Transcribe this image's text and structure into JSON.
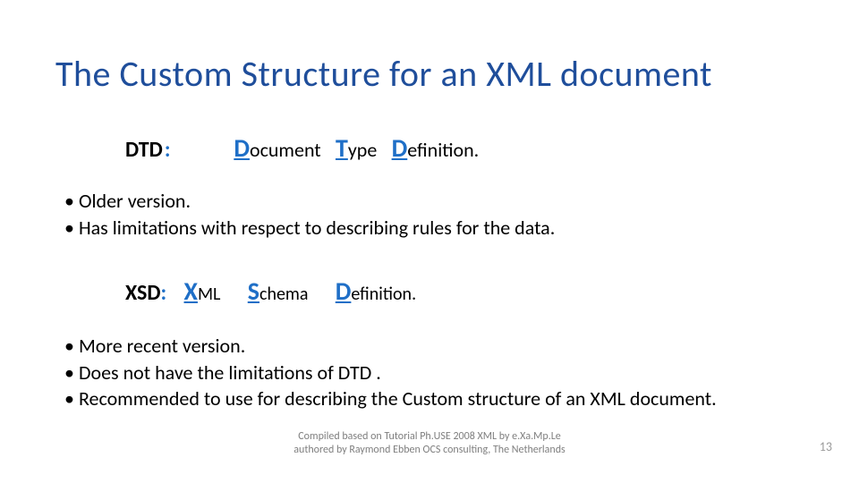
{
  "title": "The Custom  Structure for an XML document",
  "dtd": {
    "abbr": "DTD",
    "colon": ":",
    "w1_initial": "D",
    "w1_rest": "ocument",
    "w2_initial": "T",
    "w2_rest": "ype",
    "w3_initial": "D",
    "w3_rest": "efinition."
  },
  "dtd_bullets": [
    "Older version.",
    "Has limitations with respect to describing rules for the data."
  ],
  "xsd": {
    "abbr": "XSD",
    "colon": ":",
    "w1_initial": "X",
    "w1_rest": "ML",
    "w2_initial": "S",
    "w2_rest": "chema",
    "w3_initial": "D",
    "w3_rest": "efinition."
  },
  "xsd_bullets": [
    "More recent  version.",
    "Does not have the limitations of DTD .",
    "Recommended to use for describing the Custom structure of an XML document."
  ],
  "footer_line1": "Compiled based on  Tutorial Ph.USE 2008 XML by e.Xa.Mp.Le",
  "footer_line2": "authored by Raymond Ebben OCS consulting, The Netherlands",
  "page_number": "13"
}
